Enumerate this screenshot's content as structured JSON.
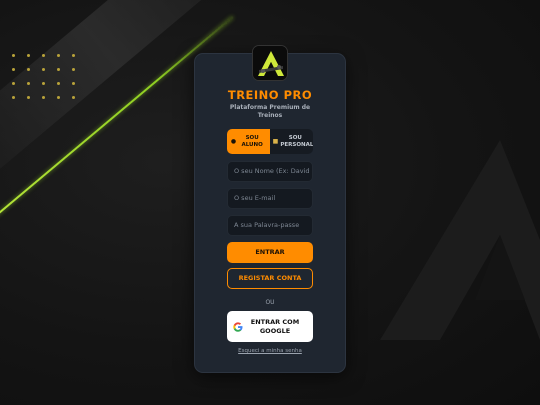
{
  "brand": {
    "title": "TREINO PRO",
    "subtitle": "Plataforma Premium de Treinos",
    "logo_icon": "brand-logo-icon",
    "accent_color": "#ff8c00",
    "green_accent": "#b7e53a"
  },
  "role_toggle": {
    "options": [
      {
        "label": "SOU ALUNO",
        "icon": "student-icon",
        "active": true
      },
      {
        "label": "SOU PERSONAL",
        "icon": "trainer-icon",
        "active": false
      }
    ]
  },
  "form": {
    "name_placeholder": "O seu Nome (Ex: David",
    "email_placeholder": "O seu E-mail",
    "password_placeholder": "A sua Palavra-passe"
  },
  "actions": {
    "login_label": "ENTRAR",
    "register_label": "REGISTAR CONTA",
    "divider_label": "OU",
    "google_label": "ENTRAR COM GOOGLE",
    "forgot_label": "Esqueci a minha senha"
  }
}
